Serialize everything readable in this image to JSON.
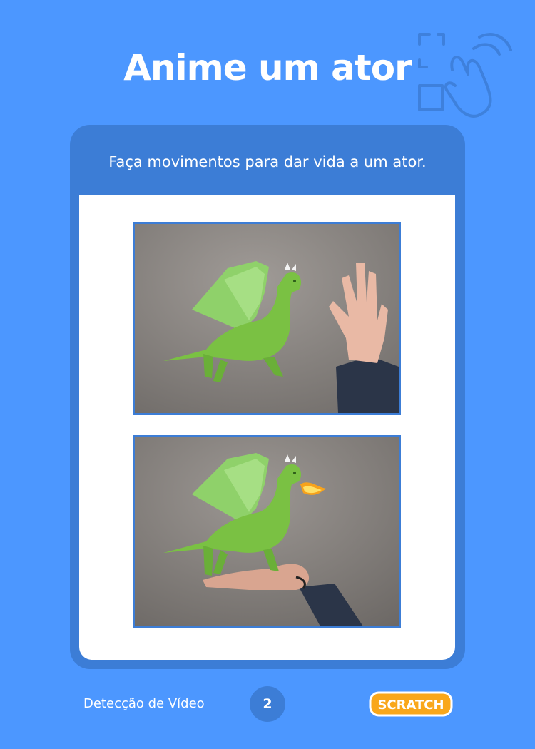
{
  "header": {
    "title": "Anime um ator",
    "icon": "video-motion-hand-icon"
  },
  "card": {
    "subtitle": "Faça movimentos para dar vida a um ator.",
    "images": [
      {
        "name": "dragon-and-waving-hand-photo"
      },
      {
        "name": "dragon-breathing-fire-on-hand-photo"
      }
    ]
  },
  "footer": {
    "extension_label": "Detecção de Vídeo",
    "page_number": "2",
    "logo_text": "SCRATCH"
  },
  "colors": {
    "background": "#4c97ff",
    "card": "#3c7dd6",
    "dragon": "#7ac143",
    "logo": "#f9a71b"
  }
}
